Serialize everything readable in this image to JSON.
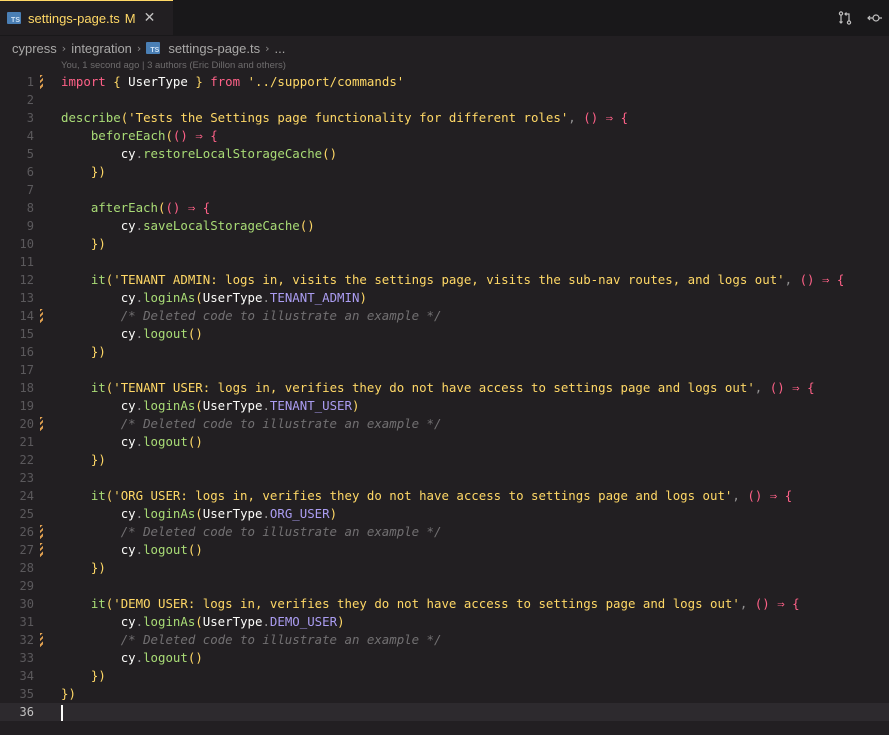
{
  "tab": {
    "badge": "TS",
    "title": "settings-page.ts",
    "modified": "M",
    "close": "✕"
  },
  "breadcrumb": {
    "parts": [
      "cypress",
      "integration",
      "settings-page.ts",
      "..."
    ],
    "separator": "›"
  },
  "blame": "You, 1 second ago | 3 authors (Eric Dillon and others)",
  "editor": {
    "current_line": 36,
    "modified_lines": [
      1,
      14,
      20,
      26,
      27,
      32
    ],
    "lines": [
      {
        "n": "1",
        "text": "import { UserType } from '../support/commands'"
      },
      {
        "n": "2",
        "text": ""
      },
      {
        "n": "3",
        "text": "describe('Tests the Settings page functionality for different roles', () ⇒ {"
      },
      {
        "n": "4",
        "text": "    beforeEach(() ⇒ {"
      },
      {
        "n": "5",
        "text": "        cy.restoreLocalStorageCache()"
      },
      {
        "n": "6",
        "text": "    })"
      },
      {
        "n": "7",
        "text": ""
      },
      {
        "n": "8",
        "text": "    afterEach(() ⇒ {"
      },
      {
        "n": "9",
        "text": "        cy.saveLocalStorageCache()"
      },
      {
        "n": "10",
        "text": "    })"
      },
      {
        "n": "11",
        "text": ""
      },
      {
        "n": "12",
        "text": "    it('TENANT ADMIN: logs in, visits the settings page, visits the sub-nav routes, and logs out', () ⇒ {"
      },
      {
        "n": "13",
        "text": "        cy.loginAs(UserType.TENANT_ADMIN)"
      },
      {
        "n": "14",
        "text": "        /* Deleted code to illustrate an example */"
      },
      {
        "n": "15",
        "text": "        cy.logout()"
      },
      {
        "n": "16",
        "text": "    })"
      },
      {
        "n": "17",
        "text": ""
      },
      {
        "n": "18",
        "text": "    it('TENANT USER: logs in, verifies they do not have access to settings page and logs out', () ⇒ {"
      },
      {
        "n": "19",
        "text": "        cy.loginAs(UserType.TENANT_USER)"
      },
      {
        "n": "20",
        "text": "        /* Deleted code to illustrate an example */"
      },
      {
        "n": "21",
        "text": "        cy.logout()"
      },
      {
        "n": "22",
        "text": "    })"
      },
      {
        "n": "23",
        "text": ""
      },
      {
        "n": "24",
        "text": "    it('ORG USER: logs in, verifies they do not have access to settings page and logs out', () ⇒ {"
      },
      {
        "n": "25",
        "text": "        cy.loginAs(UserType.ORG_USER)"
      },
      {
        "n": "26",
        "text": "        /* Deleted code to illustrate an example */"
      },
      {
        "n": "27",
        "text": "        cy.logout()"
      },
      {
        "n": "28",
        "text": "    })"
      },
      {
        "n": "29",
        "text": ""
      },
      {
        "n": "30",
        "text": "    it('DEMO USER: logs in, verifies they do not have access to settings page and logs out', () ⇒ {"
      },
      {
        "n": "31",
        "text": "        cy.loginAs(UserType.DEMO_USER)"
      },
      {
        "n": "32",
        "text": "        /* Deleted code to illustrate an example */"
      },
      {
        "n": "33",
        "text": "        cy.logout()"
      },
      {
        "n": "34",
        "text": "    })"
      },
      {
        "n": "35",
        "text": "})"
      },
      {
        "n": "36",
        "text": ""
      }
    ]
  },
  "colors": {
    "background": "#221f22",
    "keyword": "#ff6188",
    "function": "#a9dc76",
    "string": "#ffd866",
    "comment": "#727072",
    "property": "#ab9df2",
    "accent": "#ffd866"
  },
  "icons": [
    "typescript-file-icon",
    "compare-changes-icon",
    "timeline-icon",
    "close-icon"
  ]
}
